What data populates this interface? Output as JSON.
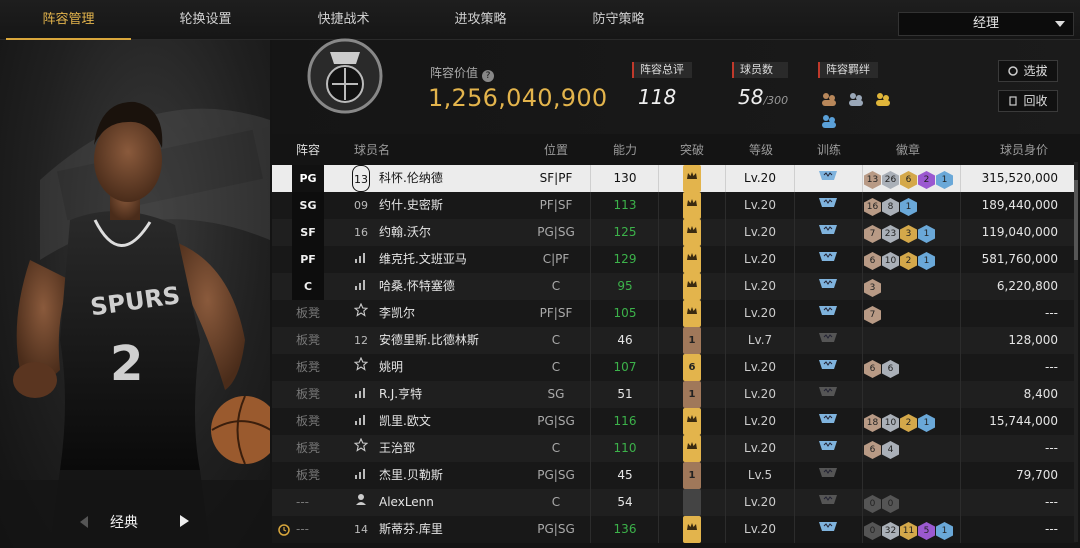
{
  "tabs": [
    {
      "label": "阵容管理",
      "active": true
    },
    {
      "label": "轮换设置",
      "active": false
    },
    {
      "label": "快捷战术",
      "active": false
    },
    {
      "label": "进攻策略",
      "active": false
    },
    {
      "label": "防守策略",
      "active": false
    }
  ],
  "role_dropdown": {
    "selected": "经理"
  },
  "player_card": {
    "variant_label": "经典"
  },
  "header": {
    "value_label": "阵容价值",
    "value": "1,256,040,900",
    "overall_label": "阵容总评",
    "overall": "118",
    "count_label": "球员数",
    "count": "58",
    "count_max": "/300",
    "bonds_label": "阵容羁绊",
    "select_button": "选拔",
    "recycle_button": "回收"
  },
  "columns": [
    "阵容",
    "球员名",
    "位置",
    "能力",
    "突破",
    "等级",
    "训练",
    "徽章",
    "球员身价"
  ],
  "rows": [
    {
      "slot": "PG",
      "icon": "13",
      "name": "科怀.伦纳德",
      "position": "SF|PF",
      "ability": "130",
      "ability_color": "white",
      "breakout": "crown-gold",
      "level": "Lv.20",
      "train": "blue",
      "badges": [
        {
          "v": "13",
          "c": "#b89a85"
        },
        {
          "v": "26",
          "c": "#aab0b8"
        },
        {
          "v": "6",
          "c": "#d4a84a"
        },
        {
          "v": "2",
          "c": "#9b59d0"
        },
        {
          "v": "1",
          "c": "#6aa8d8"
        }
      ],
      "worth": "315,520,000"
    },
    {
      "slot": "SG",
      "icon": "09",
      "name": "约什.史密斯",
      "position": "PF|SF",
      "ability": "113",
      "ability_color": "green",
      "breakout": "crown-gold",
      "level": "Lv.20",
      "train": "blue",
      "badges": [
        {
          "v": "16",
          "c": "#b89a85"
        },
        {
          "v": "8",
          "c": "#aab0b8"
        },
        {
          "v": "1",
          "c": "#6aa8d8"
        }
      ],
      "worth": "189,440,000"
    },
    {
      "slot": "SF",
      "icon": "16",
      "name": "约翰.沃尔",
      "position": "PG|SG",
      "ability": "125",
      "ability_color": "green",
      "breakout": "crown-gold",
      "level": "Lv.20",
      "train": "blue",
      "badges": [
        {
          "v": "7",
          "c": "#b89a85"
        },
        {
          "v": "23",
          "c": "#aab0b8"
        },
        {
          "v": "3",
          "c": "#d4a84a"
        },
        {
          "v": "1",
          "c": "#6aa8d8"
        }
      ],
      "worth": "119,040,000"
    },
    {
      "slot": "PF",
      "icon": "bars",
      "name": "维克托.文班亚马",
      "position": "C|PF",
      "ability": "129",
      "ability_color": "green",
      "breakout": "crown-gold",
      "level": "Lv.20",
      "train": "blue",
      "badges": [
        {
          "v": "6",
          "c": "#b89a85"
        },
        {
          "v": "10",
          "c": "#aab0b8"
        },
        {
          "v": "2",
          "c": "#d4a84a"
        },
        {
          "v": "1",
          "c": "#6aa8d8"
        }
      ],
      "worth": "581,760,000"
    },
    {
      "slot": "C",
      "icon": "bars",
      "name": "哈桑.怀特塞德",
      "position": "C",
      "ability": "95",
      "ability_color": "green",
      "breakout": "crown-gold",
      "level": "Lv.20",
      "train": "blue",
      "badges": [
        {
          "v": "3",
          "c": "#b89a85"
        }
      ],
      "worth": "6,220,800"
    },
    {
      "slot": "板凳",
      "icon": "star",
      "name": "李凯尔",
      "position": "PF|SF",
      "ability": "105",
      "ability_color": "green",
      "breakout": "crown-gold",
      "level": "Lv.20",
      "train": "blue",
      "badges": [
        {
          "v": "7",
          "c": "#b89a85"
        }
      ],
      "worth": "---"
    },
    {
      "slot": "板凳",
      "icon": "12",
      "name": "安德里斯.比德林斯",
      "position": "C",
      "ability": "46",
      "ability_color": "white",
      "breakout": "brown-1",
      "level": "Lv.7",
      "train": "gray",
      "badges": [],
      "worth": "128,000"
    },
    {
      "slot": "板凳",
      "icon": "star",
      "name": "姚明",
      "position": "C",
      "ability": "107",
      "ability_color": "green",
      "breakout": "gold-6",
      "level": "Lv.20",
      "train": "blue",
      "badges": [
        {
          "v": "6",
          "c": "#b89a85"
        },
        {
          "v": "6",
          "c": "#aab0b8"
        }
      ],
      "worth": "---"
    },
    {
      "slot": "板凳",
      "icon": "bars",
      "name": "R.J.亨特",
      "position": "SG",
      "ability": "51",
      "ability_color": "white",
      "breakout": "brown-1",
      "level": "Lv.20",
      "train": "gray",
      "badges": [],
      "worth": "8,400"
    },
    {
      "slot": "板凳",
      "icon": "bars",
      "name": "凯里.欧文",
      "position": "PG|SG",
      "ability": "116",
      "ability_color": "green",
      "breakout": "crown-gold",
      "level": "Lv.20",
      "train": "blue",
      "badges": [
        {
          "v": "18",
          "c": "#b89a85"
        },
        {
          "v": "10",
          "c": "#aab0b8"
        },
        {
          "v": "2",
          "c": "#d4a84a"
        },
        {
          "v": "1",
          "c": "#6aa8d8"
        }
      ],
      "worth": "15,744,000"
    },
    {
      "slot": "板凳",
      "icon": "star",
      "name": "王治郅",
      "position": "C",
      "ability": "110",
      "ability_color": "green",
      "breakout": "crown-gold",
      "level": "Lv.20",
      "train": "blue",
      "badges": [
        {
          "v": "6",
          "c": "#b89a85"
        },
        {
          "v": "4",
          "c": "#aab0b8"
        }
      ],
      "worth": "---"
    },
    {
      "slot": "板凳",
      "icon": "bars",
      "name": "杰里.贝勒斯",
      "position": "PG|SG",
      "ability": "45",
      "ability_color": "white",
      "breakout": "brown-1",
      "level": "Lv.5",
      "train": "gray",
      "badges": [],
      "worth": "79,700"
    },
    {
      "slot": "---",
      "icon": "person",
      "name": "AlexLenn",
      "position": "C",
      "ability": "54",
      "ability_color": "white",
      "breakout": "gray-0",
      "level": "Lv.20",
      "train": "gray",
      "badges": [
        {
          "v": "0",
          "c": "#555555"
        },
        {
          "v": "0",
          "c": "#555555"
        }
      ],
      "worth": "---"
    },
    {
      "slot": "---",
      "icon": "14",
      "name": "斯蒂芬.库里",
      "position": "PG|SG",
      "ability": "136",
      "ability_color": "green",
      "breakout": "crown-gold",
      "level": "Lv.20",
      "train": "blue",
      "badges": [
        {
          "v": "0",
          "c": "#555555"
        },
        {
          "v": "32",
          "c": "#aab0b8"
        },
        {
          "v": "11",
          "c": "#d4a84a"
        },
        {
          "v": "5",
          "c": "#9b59d0"
        },
        {
          "v": "1",
          "c": "#6aa8d8"
        }
      ],
      "worth": "---",
      "alarm": true
    }
  ],
  "colors": {
    "accent": "#e3b44c",
    "green": "#3cb24a",
    "selected_row": "#ececec"
  }
}
